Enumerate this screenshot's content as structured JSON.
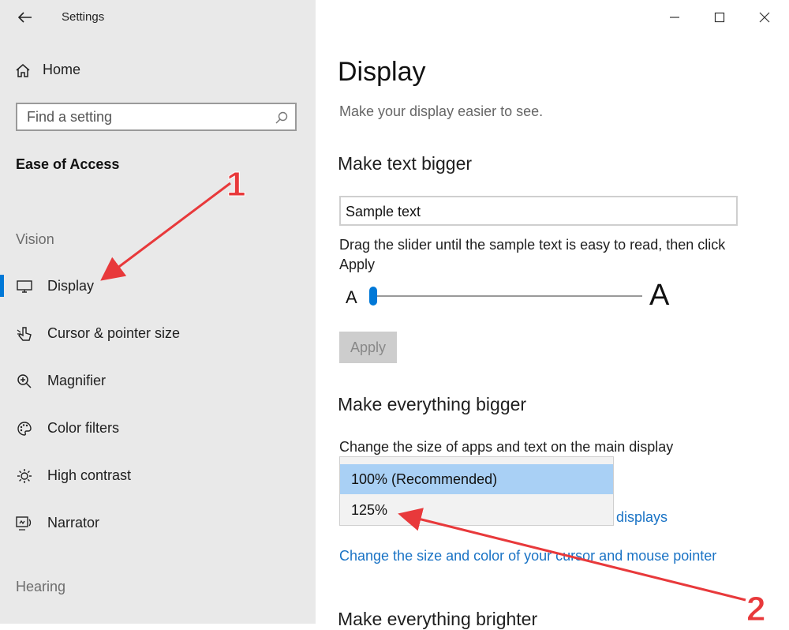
{
  "window": {
    "title": "Settings"
  },
  "sidebar": {
    "home_label": "Home",
    "search_placeholder": "Find a setting",
    "section_title": "Ease of Access",
    "group_vision": "Vision",
    "group_hearing": "Hearing",
    "items": [
      {
        "label": "Display",
        "icon": "monitor-icon",
        "active": true
      },
      {
        "label": "Cursor & pointer size",
        "icon": "cursor-icon"
      },
      {
        "label": "Magnifier",
        "icon": "magnifier-icon"
      },
      {
        "label": "Color filters",
        "icon": "palette-icon"
      },
      {
        "label": "High contrast",
        "icon": "brightness-icon"
      },
      {
        "label": "Narrator",
        "icon": "narrator-icon"
      }
    ]
  },
  "main": {
    "title": "Display",
    "subtitle": "Make your display easier to see.",
    "text_section": {
      "heading": "Make text bigger",
      "sample_text": "Sample text",
      "instructions": "Drag the slider until the sample text is easy to read, then click Apply",
      "slider_min_label": "A",
      "slider_max_label": "A",
      "slider_value_fraction": 0.0,
      "apply_label": "Apply"
    },
    "scale_section": {
      "heading": "Make everything bigger",
      "description": "Change the size of apps and text on the main display",
      "options": [
        "100% (Recommended)",
        "125%"
      ],
      "selected_index": 0,
      "link_displays": "displays",
      "link_cursor": "Change the size and color of your cursor and mouse pointer"
    },
    "brighter_heading": "Make everything brighter"
  },
  "annotations": {
    "label_1": "1",
    "label_2": "2",
    "arrow_color": "#e8393b"
  },
  "colors": {
    "accent": "#0078d7",
    "link": "#1a73c5",
    "selected_option": "#a9d0f5"
  }
}
